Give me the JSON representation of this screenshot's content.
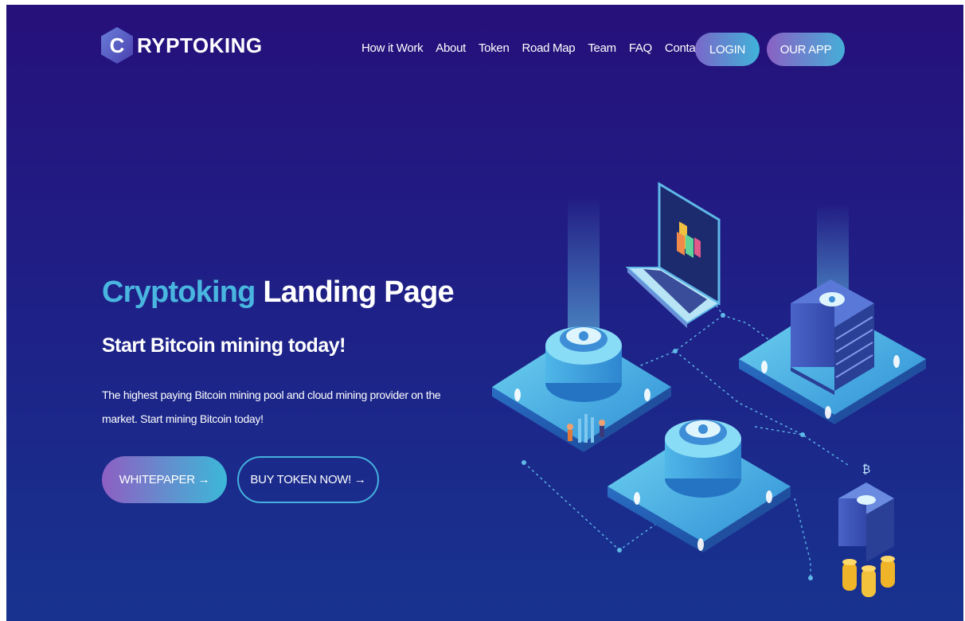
{
  "brand": {
    "letter": "C",
    "name": "RYPTOKING"
  },
  "nav": {
    "items": [
      "How it Work",
      "About",
      "Token",
      "Road Map",
      "Team",
      "FAQ",
      "Contact"
    ],
    "login_label": "LOGIN",
    "app_label": "OUR APP"
  },
  "hero": {
    "title_accent": "Cryptoking",
    "title_rest": " Landing Page",
    "subtitle": "Start Bitcoin mining today!",
    "description": "The highest paying Bitcoin mining pool and cloud mining provider on the market. Start mining Bitcoin today!",
    "whitepaper_label": "WHITEPAPER →",
    "buy_label": "BUY TOKEN NOW! →"
  },
  "icons": {
    "logo": "hexagon-logo-icon",
    "illustration": "crypto-mining-isometric-illustration",
    "arrow": "arrow-right-icon"
  },
  "colors": {
    "bg_top": "#26107a",
    "bg_bottom": "#17338f",
    "accent": "#49b6e0",
    "gradient_purple": "#8e5fc3",
    "gradient_cyan": "#3cb8d8"
  }
}
